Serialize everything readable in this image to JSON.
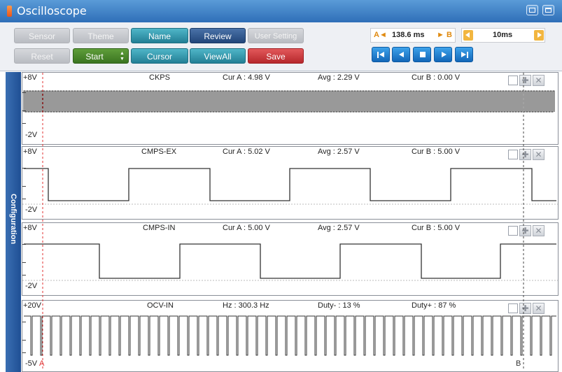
{
  "window": {
    "title": "Oscilloscope"
  },
  "toolbar": {
    "row1": [
      "Sensor",
      "Theme",
      "Name",
      "Review",
      "User Setting"
    ],
    "row2": [
      "Reset",
      "Start",
      "Cursor",
      "ViewAll",
      "Save"
    ],
    "start_stepper": "▲▼"
  },
  "cursor": {
    "a_label": "A◄",
    "a_value": "138.6 ms",
    "b_label": "► B",
    "time_div": "10ms"
  },
  "sidebar": {
    "label": "Configuration"
  },
  "channels": [
    {
      "name": "CKPS",
      "max": "+8V",
      "min": "-2V",
      "cur_a": "Cur A : 4.98 V",
      "avg": "Avg : 2.29 V",
      "cur_b": "Cur B : 0.00 V"
    },
    {
      "name": "CMPS-EX",
      "max": "+8V",
      "min": "-2V",
      "cur_a": "Cur A : 5.02 V",
      "avg": "Avg : 2.57 V",
      "cur_b": "Cur B : 5.00 V"
    },
    {
      "name": "CMPS-IN",
      "max": "+8V",
      "min": "-2V",
      "cur_a": "Cur A : 5.00 V",
      "avg": "Avg : 2.57 V",
      "cur_b": "Cur B : 5.00 V"
    },
    {
      "name": "OCV-IN",
      "max": "+20V",
      "min": "-5V",
      "cur_a": "Hz : 300.3 Hz",
      "avg": "Duty- : 13 %",
      "cur_b": "Duty+ : 87 %"
    }
  ],
  "markers": {
    "a": "A",
    "b": "B"
  },
  "colors": {
    "title_bar": "#3b7dc4",
    "trace": "#333333",
    "cursor_a": "#e03030",
    "cursor_b": "#444444",
    "sidebar": "#2a5a9e"
  }
}
